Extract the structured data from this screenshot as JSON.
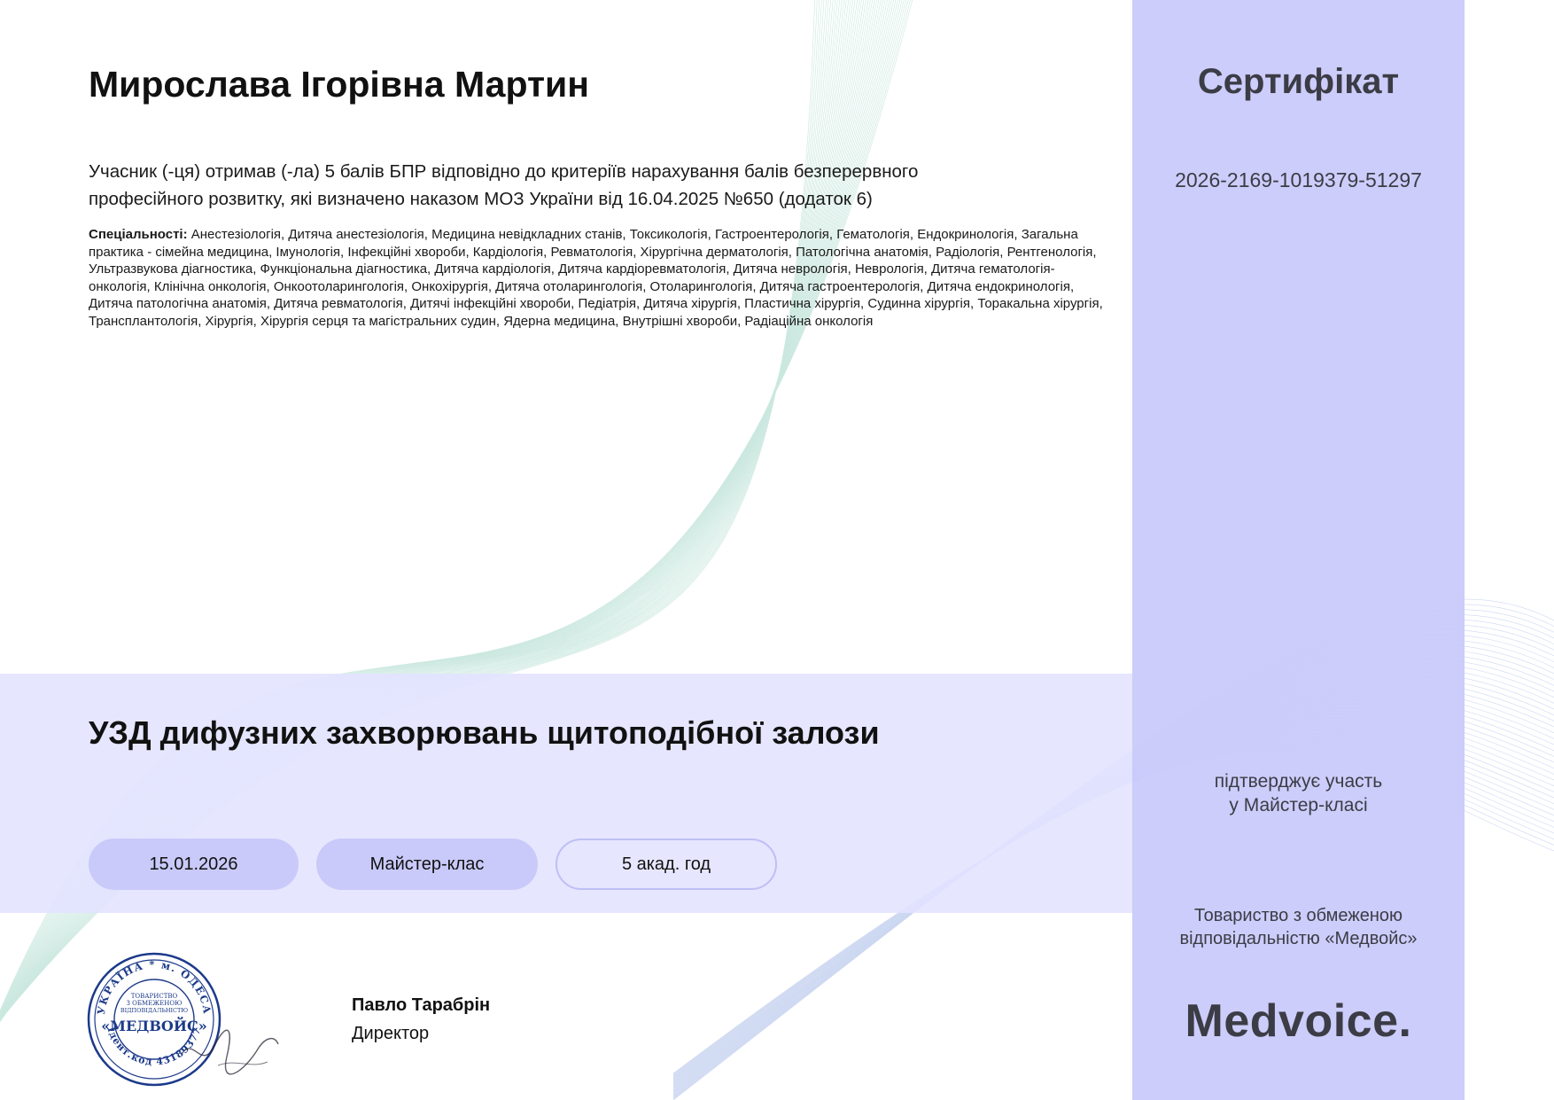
{
  "participant": {
    "name": "Мирослава Ігорівна Мартин"
  },
  "points_statement": "Учасник (-ця) отримав (-ла) 5 балів БПР відповідно до критеріїв нарахування балів безперервного професійного розвитку, які визначено наказом МОЗ України від 16.04.2025 №650 (додаток 6)",
  "specialties": {
    "label": "Спеціальності:",
    "text": "Анестезіологія, Дитяча анестезіологія, Медицина невідкладних станів, Токсикологія, Гастроентерологія, Гематологія, Ендокринологія, Загальна практика - сімейна медицина, Імунологія, Інфекційні хвороби, Кардіологія, Ревматологія, Хірургічна дерматологія, Патологічна анатомія, Радіологія, Рентгенологія, Ультразвукова діагностика, Функціональна діагностика, Дитяча кардіологія, Дитяча кардіоревматологія, Дитяча неврологія, Неврологія, Дитяча гематологія-онкологія, Клінічна онкологія, Онкоотоларингологія, Онкохірургія, Дитяча отоларингологія, Отоларингологія, Дитяча гастроентерологія, Дитяча ендокринологія, Дитяча патологічна анатомія, Дитяча ревматологія, Дитячі інфекційні хвороби, Педіатрія, Дитяча хірургія, Пластична хірургія, Судинна хірургія, Торакальна хірургія, Трансплантологія, Хірургія, Хірургія серця та магістральних судин, Ядерна медицина, Внутрішні хвороби, Радіаційна онкологія"
  },
  "course": {
    "title": "УЗД дифузних захворювань щитоподібної залози",
    "date": "15.01.2026",
    "type": "Майстер-клас",
    "hours": "5 акад. год"
  },
  "signature": {
    "name": "Павло Тарабрін",
    "role": "Директор",
    "seal_text": {
      "top": "УКРАЇНА * м. ОДЕСА",
      "inner": [
        "ТОВАРИСТВО",
        "З ОБМЕЖЕНОЮ",
        "ВІДПОВІДАЛЬНІСТЮ"
      ],
      "center": "«МЕДВОЙС»",
      "bottom": "Ідент.код 43189377"
    }
  },
  "certificate": {
    "title": "Сертифікат",
    "number": "2026-2169-1019379-51297",
    "confirm_line1": "підтверджує участь",
    "confirm_line2": "у Майстер-класі",
    "org_line1": "Товариство з обмеженою",
    "org_line2": "відповідальністю «Медвойс»",
    "logo_text": "Medvoice."
  },
  "colors": {
    "sidebar": "#c8c9fa",
    "band": "#e2e3ff",
    "chip": "#c9caf9",
    "seal": "#1c3a8a",
    "wave_line": "#9fd8c8"
  },
  "icons": {
    "seal": "company-seal-icon",
    "signature": "handwritten-signature-icon"
  }
}
